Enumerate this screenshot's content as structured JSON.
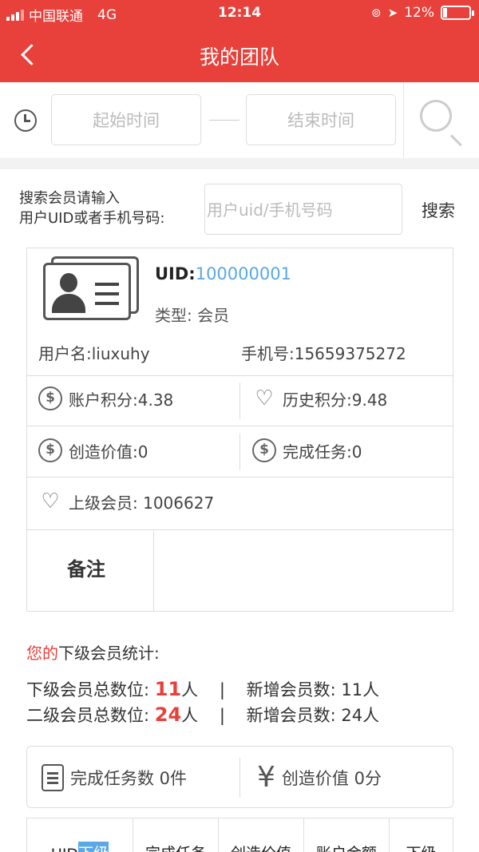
{
  "status_bar": {
    "carrier": "中国联通",
    "network": "4G",
    "time": "12:14",
    "battery": "12%"
  },
  "header": {
    "title": "我的团队"
  },
  "date_filter": {
    "start_placeholder": "起始时间",
    "end_placeholder": "结束时间"
  },
  "search": {
    "label_line1": "搜索会员请输入",
    "label_line2": "用户UID或者手机号码:",
    "placeholder": "用户uid/手机号码",
    "button": "搜索"
  },
  "member": {
    "uid_label": "UID:",
    "uid": "100000001",
    "type": "类型:  会员",
    "username": "用户名:liuxuhy",
    "phone": "手机号:15659375272",
    "account_points": "账户积分:4.38",
    "history_points": "历史积分:9.48",
    "created_value": "创造价值:0",
    "completed_tasks": "完成任务:0",
    "superior": "上级会员:  1006627",
    "note_label": "备注"
  },
  "stats": {
    "title_red": "您的",
    "title_rest": "下级会员统计:",
    "line1_prefix": "下级会员总数位:",
    "line1_num": "11",
    "line1_unit": "人",
    "line1_sep": "|",
    "line1_new": "新增会员数:  11人",
    "line2_prefix": "二级会员总数位:",
    "line2_num": "24",
    "line2_unit": "人",
    "line2_sep": "|",
    "line2_new": "新增会员数:  24人"
  },
  "summary": {
    "tasks": "完成任务数  0件",
    "value": "创造价值  0分"
  },
  "table": {
    "col1_a": "UID ",
    "col1_b": "下级",
    "col2": "完成任务",
    "col3": "创造价值",
    "col4": "账户金额",
    "col5": "下级"
  },
  "colors": {
    "brand": "#e8403a",
    "link": "#5aa8e6"
  }
}
